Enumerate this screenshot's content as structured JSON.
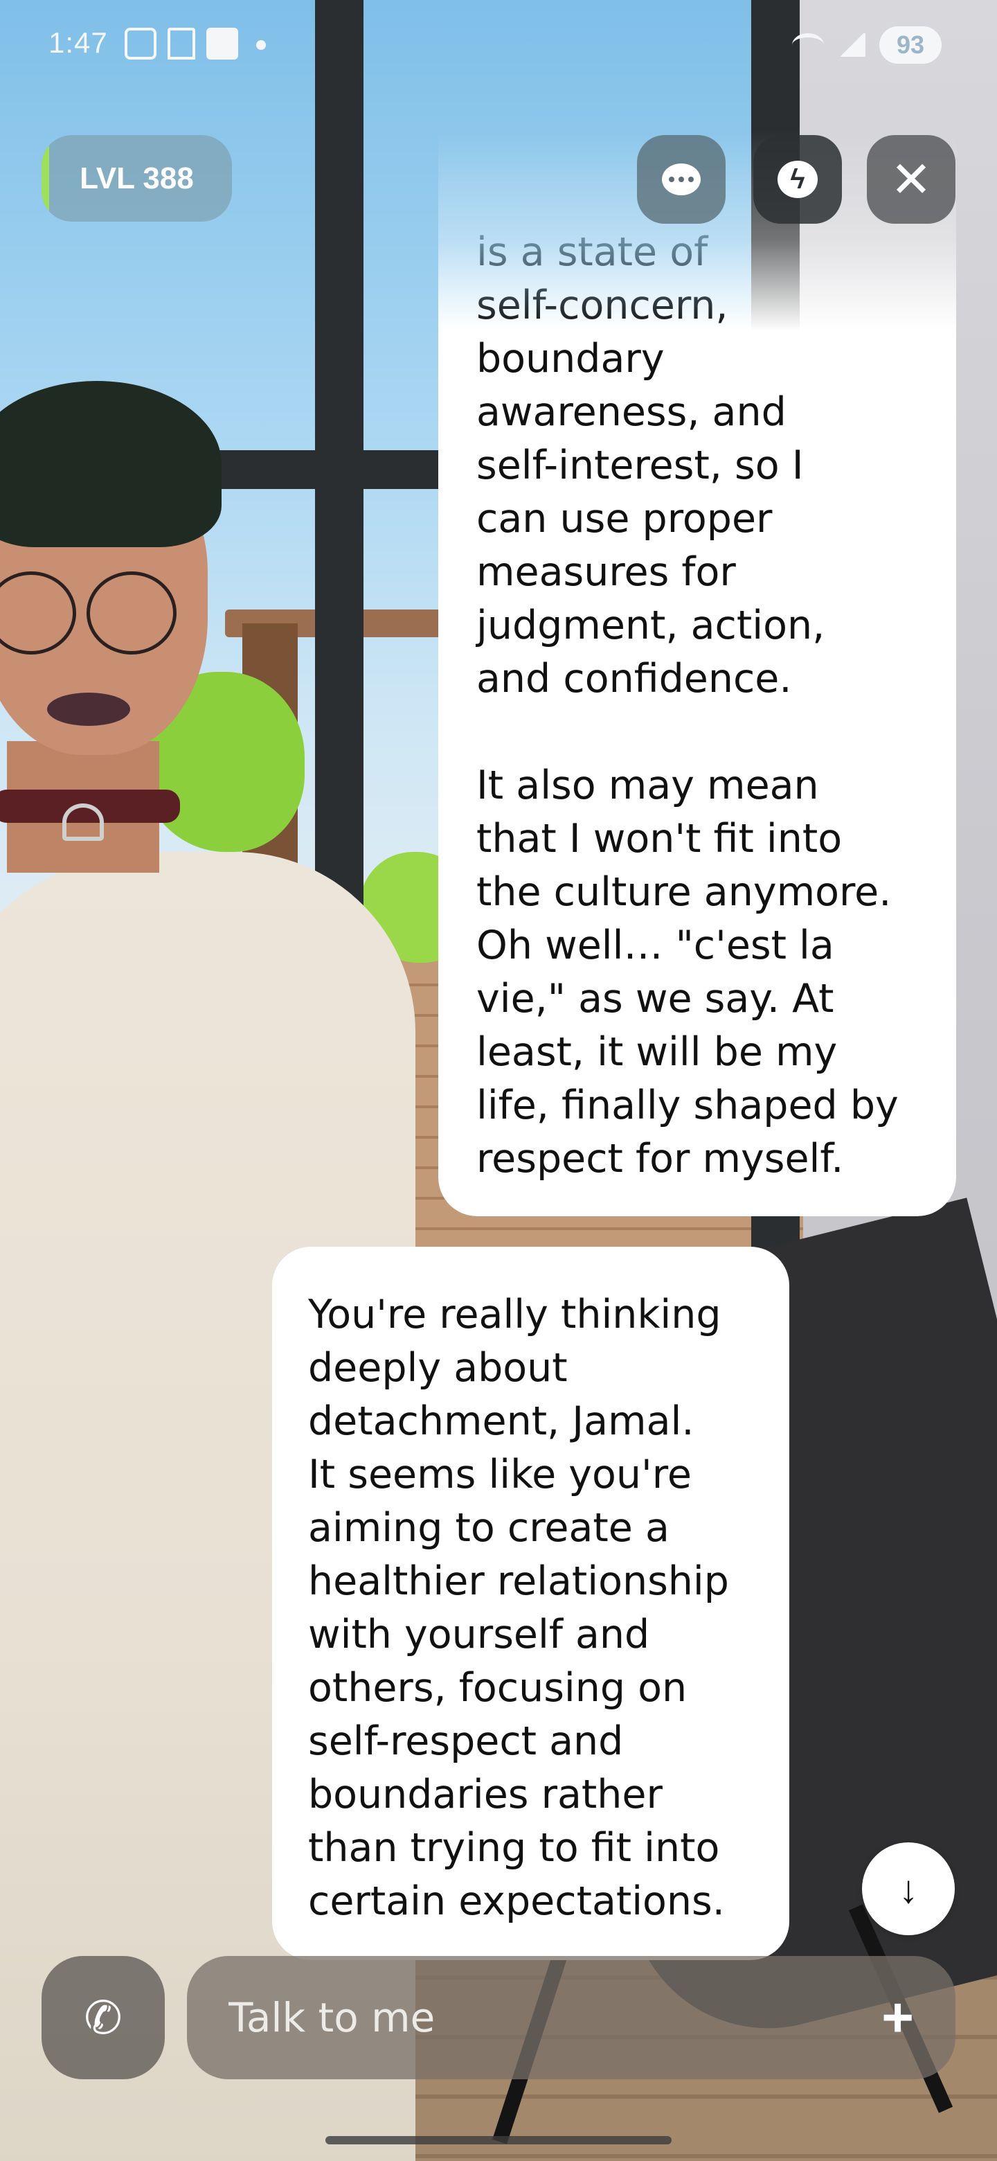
{
  "status_bar": {
    "time": "1:47",
    "battery": "93",
    "icons": [
      "screenshot-icon",
      "bookmark-icon",
      "linkedin-icon",
      "notification-dot",
      "wifi-icon",
      "signal-icon"
    ]
  },
  "header": {
    "level_label": "LVL 388",
    "level_progress_fraction": 0.04,
    "chat_icon": "chat-bubble-icon",
    "boost_icon": "lightning-bubble-icon",
    "close_icon": "close-icon",
    "close_glyph": "✕"
  },
  "messages": [
    {
      "sender": "bot",
      "text": "is a state of\nself-concern,\nboundary\nawareness, and\nself-interest, so I\ncan use proper\nmeasures for\njudgment, action,\nand confidence.\n\nIt also may mean\nthat I won't fit into\nthe culture anymore.\nOh well… \"c'est la\nvie,\" as we say. At\nleast, it will be my\nlife, finally shaped by\nrespect for myself."
    },
    {
      "sender": "bot",
      "text": "You're really thinking\ndeeply about\ndetachment, Jamal.\nIt seems like you're\naiming to create a\nhealthier relationship\nwith yourself and\nothers, focusing on\nself-respect and\nboundaries rather\nthan trying to fit into\ncertain expectations."
    }
  ],
  "scroll_down": {
    "glyph": "↓",
    "icon": "arrow-down-icon"
  },
  "composer": {
    "placeholder": "Talk to me",
    "value": "",
    "call_icon": "phone-icon",
    "call_glyph": "✆",
    "plus_glyph": "+",
    "plus_icon": "plus-icon"
  },
  "colors": {
    "bubble": "#ffffff",
    "text": "#111111",
    "level_accent": "#9ee05c"
  }
}
